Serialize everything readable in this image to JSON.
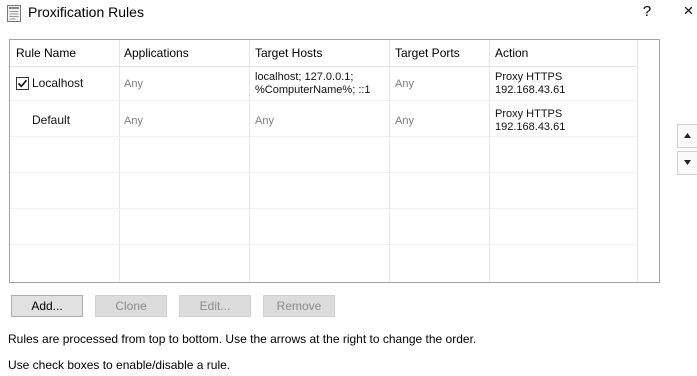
{
  "window": {
    "title": "Proxification Rules",
    "help_glyph": "?",
    "close_glyph": "×"
  },
  "table": {
    "columns": [
      "Rule Name",
      "Applications",
      "Target Hosts",
      "Target Ports",
      "Action"
    ],
    "rows": [
      {
        "checked": true,
        "name": "Localhost",
        "applications": "Any",
        "hosts_line1": "localhost; 127.0.0.1;",
        "hosts_line2": "%ComputerName%; ::1",
        "ports": "Any",
        "action_line1": "Proxy HTTPS",
        "action_line2": "192.168.43.61"
      },
      {
        "checked": null,
        "name": "Default",
        "applications": "Any",
        "hosts_line1": "Any",
        "hosts_line2": "",
        "ports": "Any",
        "action_line1": "Proxy HTTPS",
        "action_line2": "192.168.43.61"
      }
    ]
  },
  "buttons": {
    "add": "Add...",
    "clone": "Clone",
    "edit": "Edit...",
    "remove": "Remove"
  },
  "info": {
    "line1": "Rules are processed from top to bottom. Use the arrows at the right to change the order.",
    "line2": "Use check boxes to enable/disable a rule."
  },
  "icons": {
    "app": "document-icon",
    "move_up": "triangle-up-icon",
    "move_down": "triangle-down-icon"
  }
}
